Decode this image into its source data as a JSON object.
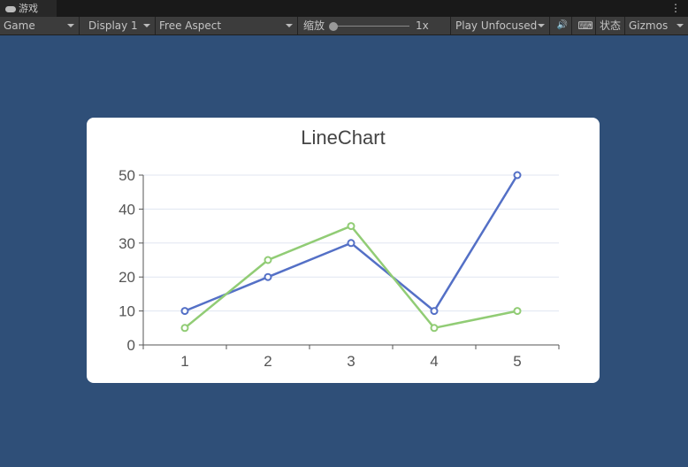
{
  "tab": {
    "label": "游戏",
    "icon": "gamepad-icon"
  },
  "toolbar": {
    "view": "Game",
    "display": "Display 1",
    "aspect": "Free Aspect",
    "scale_label": "缩放",
    "scale_value": "1x",
    "scale_level": 0,
    "play_mode": "Play Unfocused",
    "stats": "状态",
    "gizmos": "Gizmos"
  },
  "chart_data": {
    "type": "line",
    "title": "LineChart",
    "categories": [
      "1",
      "2",
      "3",
      "4",
      "5"
    ],
    "ylim": [
      0,
      50
    ],
    "yticks": [
      "0",
      "10",
      "20",
      "30",
      "40",
      "50"
    ],
    "grid": true,
    "series": [
      {
        "values": [
          10,
          20,
          30,
          10,
          50
        ],
        "color": "#5470c6"
      },
      {
        "values": [
          5,
          25,
          35,
          5,
          10
        ],
        "color": "#91cc75"
      }
    ]
  }
}
